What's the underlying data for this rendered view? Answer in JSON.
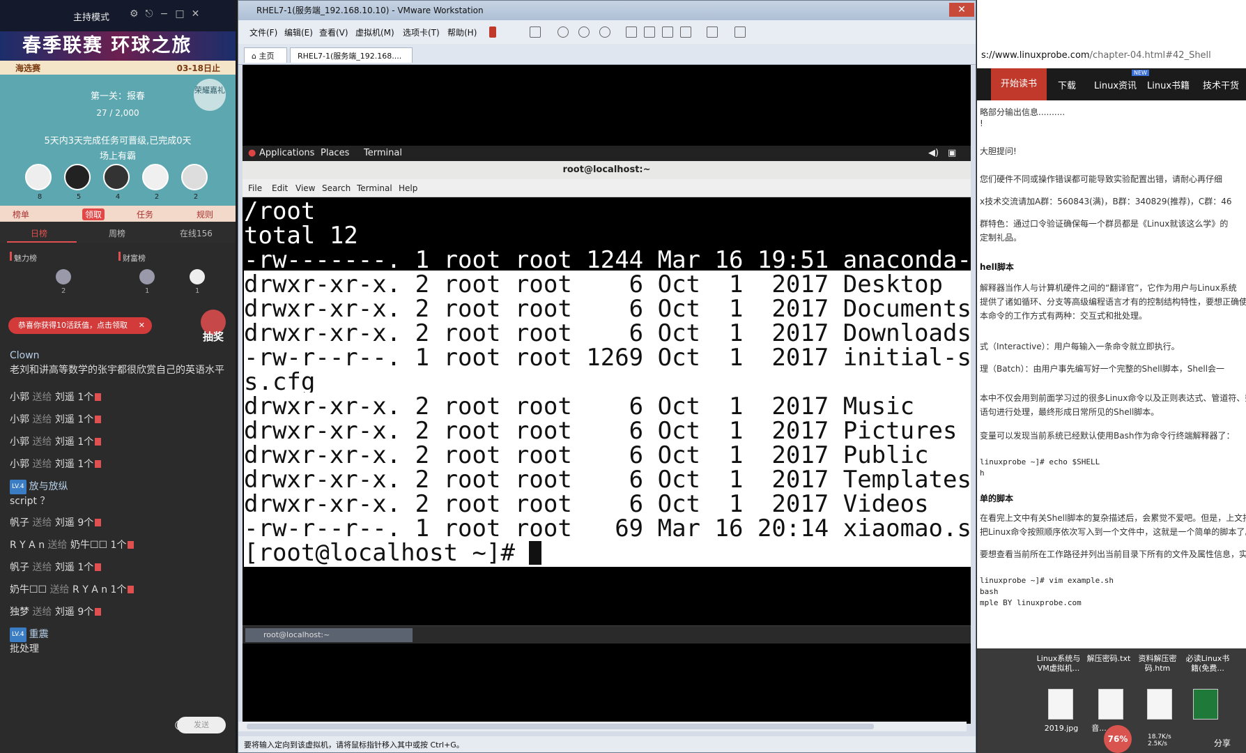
{
  "live": {
    "mode": "主持模式",
    "banner": "春季联赛 环球之旅",
    "stage_left": "海选赛",
    "stage_right": "03-18日止",
    "task_title": "第一关：报春",
    "task_progress": "27 / 2,000",
    "task_note": "5天内3天完成任务可晋级,已完成0天",
    "task_sub": "场上有霸",
    "badge": "荣耀嘉礼",
    "avatars": [
      "8",
      "5",
      "4",
      "2",
      "2"
    ],
    "tabs": [
      "榜单",
      "领取",
      "任务",
      "规则"
    ],
    "rank_tabs": [
      "日榜",
      "周榜",
      "在线156"
    ],
    "rank_sub": [
      "魅力榜",
      "财富榜"
    ],
    "rank_nums": [
      "2",
      "1",
      "1"
    ],
    "gift_popup": "恭喜你获得10活跃值，点击领取",
    "gift_close": "✕",
    "lottery": "抽奖",
    "chat_input": "发送",
    "emoji": "☺",
    "messages": [
      {
        "user": "Clown",
        "text": "老刘和讲高等数学的张宇都很欣赏自己的英语水平"
      },
      {
        "user": "小郭",
        "action": "送给",
        "target": "刘遥 1个"
      },
      {
        "user": "小郭",
        "action": "送给",
        "target": "刘遥 1个"
      },
      {
        "user": "小郭",
        "action": "送给",
        "target": "刘遥 1个"
      },
      {
        "user": "小郭",
        "action": "送给",
        "target": "刘遥 1个"
      },
      {
        "level": "LV.4",
        "user": "放与放纵",
        "text": "script ？"
      },
      {
        "user": "帆子",
        "action": "送给",
        "target": "刘遥 9个"
      },
      {
        "user": "R Y A n",
        "action": "送给",
        "target": "奶牛☐☐ 1个"
      },
      {
        "user": "帆子",
        "action": "送给",
        "target": "刘遥 1个"
      },
      {
        "user": "奶牛☐☐",
        "action": "送给",
        "target": "R Y A n 1个"
      },
      {
        "user": "独梦",
        "action": "送给",
        "target": "刘遥 9个"
      },
      {
        "level": "LV.4",
        "user": "重震",
        "text": "批处理"
      }
    ]
  },
  "vmware": {
    "title": "RHEL7-1(服务端_192.168.10.10) - VMware Workstation",
    "close": "✕",
    "menu": [
      "文件(F)",
      "编辑(E)",
      "查看(V)",
      "虚拟机(M)",
      "选项卡(T)",
      "帮助(H)"
    ],
    "tabs": [
      "主页",
      "RHEL7-1(服务端_192.168...."
    ],
    "status": "要将输入定向到该虚拟机，请将鼠标指针移入其中或按 Ctrl+G。"
  },
  "gnome": {
    "menu": [
      "Applications",
      "Places",
      "Terminal"
    ]
  },
  "terminal": {
    "title": "root@localhost:~",
    "menu": [
      "File",
      "Edit",
      "View",
      "Search",
      "Terminal",
      "Help"
    ],
    "lines": [
      "/root",
      "total 12",
      "-rw-------. 1 root root 1244 Mar 16 19:51 anaconda-",
      "drwxr-xr-x. 2 root root    6 Oct  1  2017 Desktop",
      "drwxr-xr-x. 2 root root    6 Oct  1  2017 Documents",
      "drwxr-xr-x. 2 root root    6 Oct  1  2017 Downloads",
      "-rw-r--r--. 1 root root 1269 Oct  1  2017 initial-se",
      "s.cfg",
      "drwxr-xr-x. 2 root root    6 Oct  1  2017 Music",
      "drwxr-xr-x. 2 root root    6 Oct  1  2017 Pictures",
      "drwxr-xr-x. 2 root root    6 Oct  1  2017 Public",
      "drwxr-xr-x. 2 root root    6 Oct  1  2017 Templates",
      "drwxr-xr-x. 2 root root    6 Oct  1  2017 Videos",
      "-rw-r--r--. 1 root root   69 Mar 16 20:14 xiaomao.s"
    ],
    "prompt": "[root@localhost ~]# ",
    "taskbar_item": "root@localhost:~"
  },
  "browser": {
    "url_domain": "s://www.linuxprobe.com",
    "url_path": "/chapter-04.html#42_Shell",
    "nav": [
      "开始读书",
      "下载",
      "Linux资讯",
      "Linux书籍",
      "技术干货"
    ],
    "nav_new": "NEW",
    "article": [
      "略部分输出信息..........",
      "!",
      "大胆提问!",
      "您们硬件不同或操作错误都可能导致实验配置出错，请耐心再仔细",
      "x技术交流请加A群：560843(满)，B群：340829(推荐)，C群：46",
      "群特色：通过口令验证确保每一个群员都是《Linux就该这么学》的",
      "定制礼品。",
      "hell脚本",
      "解释器当作人与计算机硬件之间的“翻译官”，它作为用户与Linux系统",
      "提供了诸如循环、分支等高级编程语言才有的控制结构特性，要想正确使用Sh",
      "本命令的工作方式有两种：交互式和批处理。",
      "式（Interactive）：用户每输入一条命令就立即执行。",
      "理（Batch）：由用户事先编写好一个完整的Shell脚本，Shell会一",
      "本中不仅会用到前面学习过的很多Linux命令以及正则表达式、管道符、数据流",
      "语句进行处理，最终形成日常所见的Shell脚本。",
      "变量可以发现当前系统已经默认使用Bash作为命令行终端解释器了：",
      "linuxprobe ~]# echo $SHELL",
      "h",
      "单的脚本",
      "在看完上文中有关Shell脚本的复杂描述后，会累觉不爱吧。但是，上文指的",
      "把Linux命令按照顺序依次写入到一个文件中，这就是一个简单的脚本了。",
      "要想查看当前所在工作路径并列出当前目录下所有的文件及属性信息，实现这个",
      "linuxprobe ~]# vim example.sh",
      "bash",
      "mple BY linuxprobe.com"
    ],
    "desktop_icons": [
      "Linux系统与VM虚拟机...",
      "解压密码.txt",
      "资料解压密码.htm",
      "必读Linux书籍(免费..."
    ],
    "desktop_files": [
      "2019.jpg",
      "音..."
    ],
    "battery_pct": "76%",
    "net_up": "18.7K/s",
    "net_down": "2.5K/s",
    "share": "分享"
  }
}
